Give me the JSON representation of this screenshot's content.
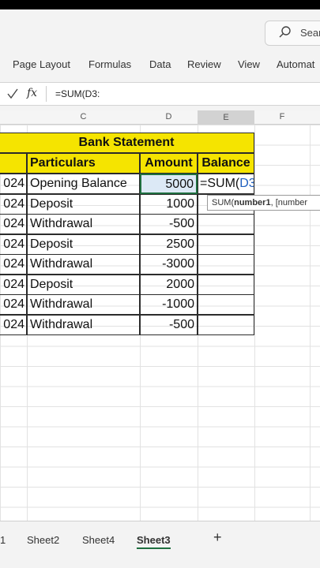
{
  "search": {
    "label": "Sear"
  },
  "ribbon": {
    "tabs": [
      "Page Layout",
      "Formulas",
      "Data",
      "Review",
      "View",
      "Automat"
    ]
  },
  "formula_bar": {
    "fx_label": "fx",
    "formula": "=SUM(D3:"
  },
  "columns": [
    "C",
    "D",
    "E",
    "F"
  ],
  "table": {
    "title": "Bank Statement",
    "headers": {
      "particulars": "Particulars",
      "amount": "Amount",
      "balance": "Balance"
    },
    "rows": [
      {
        "year": "024",
        "particulars": "Opening Balance",
        "amount": "5000",
        "balance": "=SUM(",
        "balance_ref": "D3:"
      },
      {
        "year": "024",
        "particulars": "Deposit",
        "amount": "1000",
        "balance": ""
      },
      {
        "year": "024",
        "particulars": "Withdrawal",
        "amount": "-500",
        "balance": ""
      },
      {
        "year": "024",
        "particulars": "Deposit",
        "amount": "2500",
        "balance": ""
      },
      {
        "year": "024",
        "particulars": "Withdrawal",
        "amount": "-3000",
        "balance": ""
      },
      {
        "year": "024",
        "particulars": "Deposit",
        "amount": "2000",
        "balance": ""
      },
      {
        "year": "024",
        "particulars": "Withdrawal",
        "amount": "-1000",
        "balance": ""
      },
      {
        "year": "024",
        "particulars": "Withdrawal",
        "amount": "-500",
        "balance": ""
      }
    ]
  },
  "tooltip": {
    "fn": "SUM(",
    "arg1": "number1",
    "rest": ", [number"
  },
  "sheets": {
    "tabs": [
      "1",
      "Sheet2",
      "Sheet4",
      "Sheet3"
    ],
    "active": "Sheet3",
    "add": "+"
  },
  "colors": {
    "header_fill": "#f5e400",
    "selection": "#1f6f3f",
    "ref_blue": "#1f5fbf"
  }
}
